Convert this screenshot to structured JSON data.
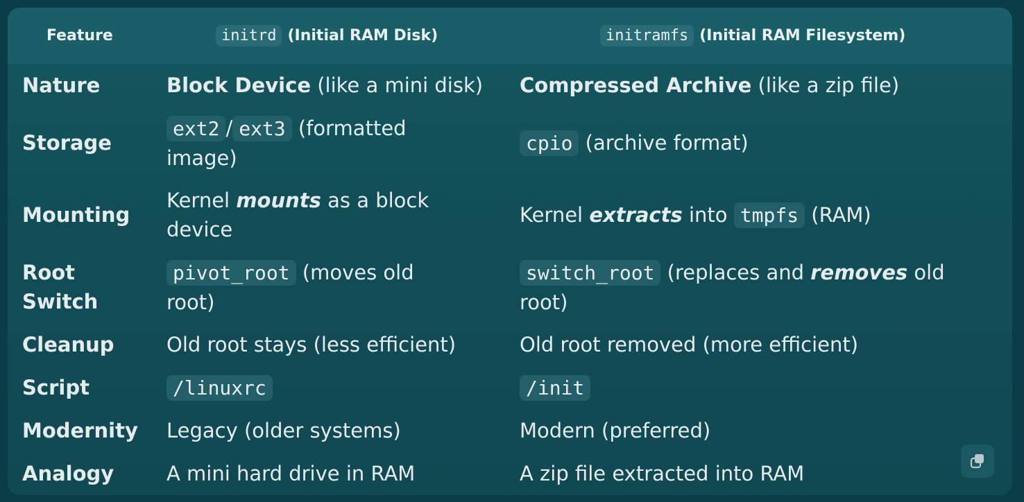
{
  "header": {
    "feature": "Feature",
    "col2_code": "initrd",
    "col2_label": "(Initial RAM Disk)",
    "col3_code": "initramfs",
    "col3_label": "(Initial RAM Filesystem)"
  },
  "rows": {
    "nature": {
      "label": "Nature",
      "c2_bold": "Block Device",
      "c2_rest": " (like a mini disk)",
      "c3_bold": "Compressed Archive",
      "c3_rest": " (like a zip file)"
    },
    "storage": {
      "label": "Storage",
      "c2_code1": "ext2",
      "c2_sep": "/",
      "c2_code2": "ext3",
      "c2_rest": " (formatted image)",
      "c3_code": "cpio",
      "c3_rest": " (archive format)"
    },
    "mounting": {
      "label": "Mounting",
      "c2_pre": "Kernel ",
      "c2_em": "mounts",
      "c2_rest": " as a block device",
      "c3_pre": "Kernel ",
      "c3_em": "extracts",
      "c3_mid": " into ",
      "c3_code": "tmpfs",
      "c3_rest": " (RAM)"
    },
    "root_switch": {
      "label": "Root Switch",
      "c2_code": "pivot_root",
      "c2_rest": " (moves old root)",
      "c3_code": "switch_root",
      "c3_mid": " (replaces and ",
      "c3_em": "removes",
      "c3_rest": " old root)"
    },
    "cleanup": {
      "label": "Cleanup",
      "c2": "Old root stays (less efficient)",
      "c3": "Old root removed (more efficient)"
    },
    "script": {
      "label": "Script",
      "c2_code": "/linuxrc",
      "c3_code": "/init"
    },
    "modernity": {
      "label": "Modernity",
      "c2": "Legacy (older systems)",
      "c3": "Modern (preferred)"
    },
    "analogy": {
      "label": "Analogy",
      "c2": "A mini hard drive in RAM",
      "c3": "A zip file extracted into RAM"
    }
  },
  "icons": {
    "copy": "copy-icon"
  },
  "colors": {
    "background": "#0a3d47",
    "panel": "#155760",
    "header": "#1a5e68",
    "code_bg": "#235f69",
    "text": "#e4ecee"
  }
}
